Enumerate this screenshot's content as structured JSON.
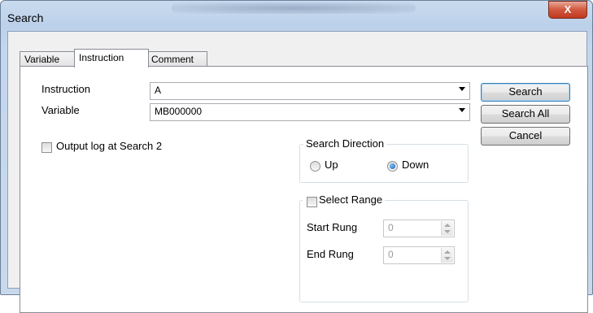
{
  "window": {
    "title": "Search",
    "close_glyph": "X"
  },
  "tabs": [
    {
      "label": "Variable"
    },
    {
      "label": "Instruction"
    },
    {
      "label": "Comment"
    }
  ],
  "active_tab": "Instruction",
  "form": {
    "instruction_label": "Instruction",
    "instruction_value": "A",
    "variable_label": "Variable",
    "variable_value": "MB000000",
    "output_log_label": "Output log at Search 2",
    "output_log_checked": false
  },
  "buttons": {
    "search": "Search",
    "search_all": "Search All",
    "cancel": "Cancel"
  },
  "direction": {
    "title": "Search Direction",
    "up": "Up",
    "down": "Down",
    "selected": "Down"
  },
  "range": {
    "title": "Select Range",
    "checked": false,
    "start_label": "Start Rung",
    "start_value": "0",
    "end_label": "End Rung",
    "end_value": "0"
  }
}
